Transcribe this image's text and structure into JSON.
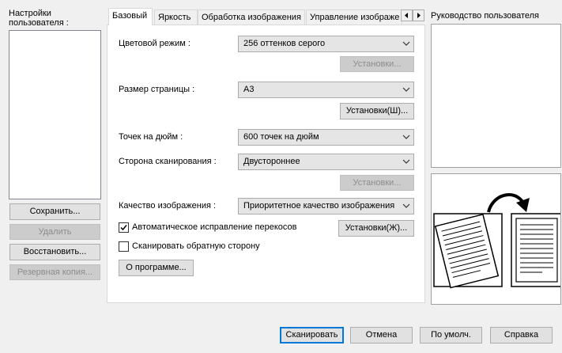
{
  "left_panel": {
    "title": "Настройки\nпользователя :",
    "buttons": {
      "save": "Сохранить...",
      "delete": "Удалить",
      "restore": "Восстановить...",
      "backup": "Резервная копия..."
    }
  },
  "tabs": [
    {
      "label": "Базовый"
    },
    {
      "label": "Яркость"
    },
    {
      "label": "Обработка изображения"
    },
    {
      "label": "Управление изображе"
    }
  ],
  "basic": {
    "color_mode": {
      "label": "Цветовой режим :",
      "value": "256 оттенков серого",
      "settings": "Установки..."
    },
    "page_size": {
      "label": "Размер страницы :",
      "value": "A3",
      "settings": "Установки(Ш)..."
    },
    "dpi": {
      "label": "Точек на дюйм :",
      "value": "600 точек на дюйм"
    },
    "scan_side": {
      "label": "Сторона сканирования :",
      "value": "Двустороннее",
      "settings": "Установки..."
    },
    "image_quality": {
      "label": "Качество изображения :",
      "value": "Приоритетное качество изображения"
    },
    "deskew": {
      "label": "Автоматическое исправление перекосов",
      "checked": true,
      "settings": "Установки(Ж)..."
    },
    "scan_back": {
      "label": "Сканировать обратную сторону",
      "checked": false
    },
    "about": "О программе..."
  },
  "guide": {
    "title": "Руководство пользователя"
  },
  "bottom_buttons": {
    "scan": "Сканировать",
    "cancel": "Отмена",
    "default": "По умолч.",
    "help": "Справка"
  }
}
